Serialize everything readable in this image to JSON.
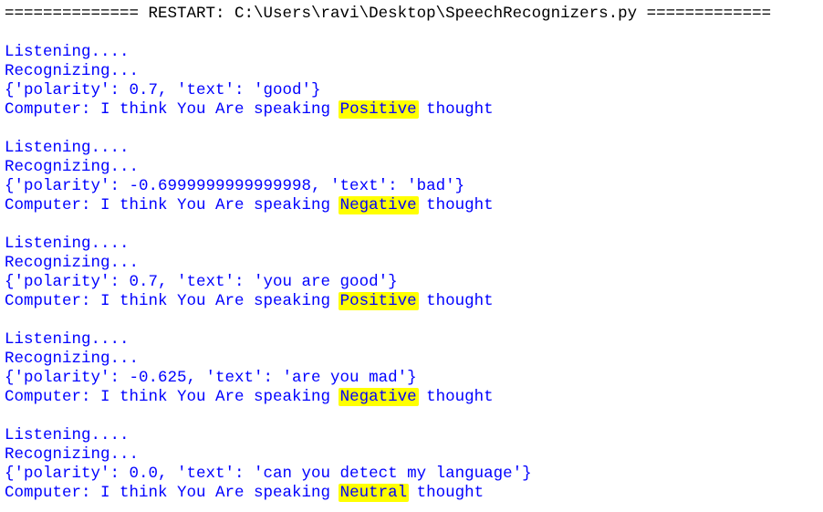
{
  "restart_line": "============== RESTART: C:\\Users\\ravi\\Desktop\\SpeechRecognizers.py =============",
  "blocks": [
    {
      "listening": "Listening....",
      "recognizing": "Recognizing...",
      "result": "{'polarity': 0.7, 'text': 'good'}",
      "computer_prefix": "Computer: I think You Are speaking ",
      "sentiment": "Positive",
      "computer_suffix": " thought"
    },
    {
      "listening": "Listening....",
      "recognizing": "Recognizing...",
      "result": "{'polarity': -0.6999999999999998, 'text': 'bad'}",
      "computer_prefix": "Computer: I think You Are speaking ",
      "sentiment": "Negative",
      "computer_suffix": " thought"
    },
    {
      "listening": "Listening....",
      "recognizing": "Recognizing...",
      "result": "{'polarity': 0.7, 'text': 'you are good'}",
      "computer_prefix": "Computer: I think You Are speaking ",
      "sentiment": "Positive",
      "computer_suffix": " thought"
    },
    {
      "listening": "Listening....",
      "recognizing": "Recognizing...",
      "result": "{'polarity': -0.625, 'text': 'are you mad'}",
      "computer_prefix": "Computer: I think You Are speaking ",
      "sentiment": "Negative",
      "computer_suffix": " thought"
    },
    {
      "listening": "Listening....",
      "recognizing": "Recognizing...",
      "result": "{'polarity': 0.0, 'text': 'can you detect my language'}",
      "computer_prefix": "Computer: I think You Are speaking ",
      "sentiment": "Neutral",
      "computer_suffix": " thought"
    }
  ],
  "colors": {
    "output_text": "#0000ff",
    "restart_text": "#000000",
    "highlight": "#ffff00",
    "background": "#ffffff"
  }
}
